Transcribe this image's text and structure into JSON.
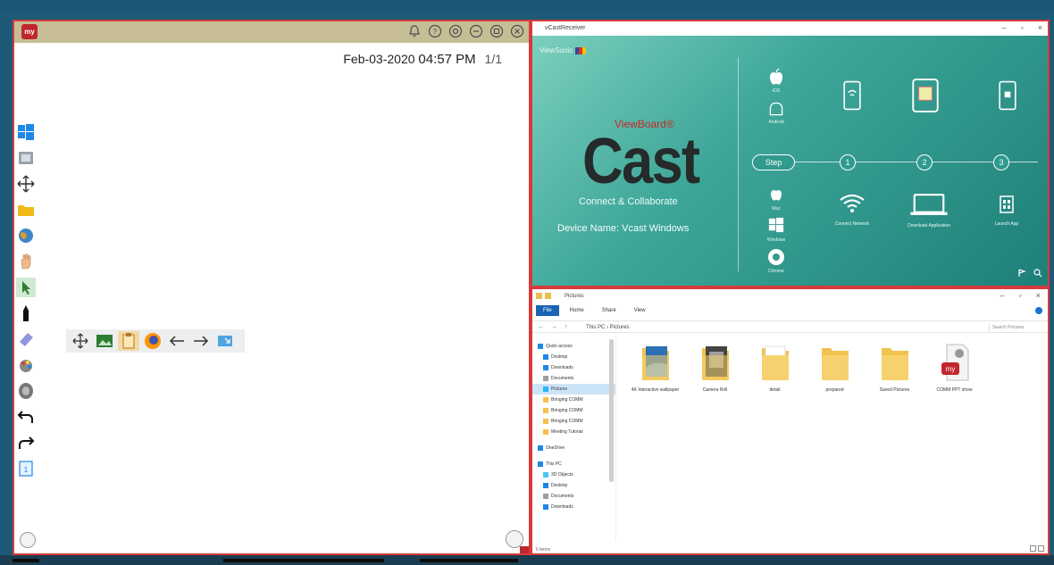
{
  "whiteboard": {
    "logo_text": "my",
    "date": "Feb-03-2020",
    "time": "04:57 PM",
    "page": "1/1",
    "header_icons": [
      "bell-icon",
      "help-icon",
      "settings-icon",
      "minimize-icon",
      "maximize-icon",
      "close-icon"
    ],
    "tools": [
      "windows-icon",
      "screenshot-icon",
      "move-icon",
      "folder-icon",
      "globe-icon",
      "hand-icon",
      "select-icon",
      "pen-icon",
      "eraser-icon",
      "color-palette-icon",
      "zoom-icon",
      "undo-icon",
      "redo-icon",
      "page-icon"
    ],
    "floating_toolbar": [
      "move-icon",
      "image-icon",
      "clipboard-icon",
      "firefox-icon",
      "arrow-left-icon",
      "arrow-right-icon",
      "screen-icon"
    ]
  },
  "cast": {
    "window_title": "vCastReceiver",
    "brand": "ViewSonic",
    "label": "ViewBoard®",
    "title": "Cast",
    "subtitle": "Connect & Collaborate",
    "device_name": "Device Name: Vcast Windows",
    "step_pill": "Step",
    "steps": [
      "1",
      "2",
      "3"
    ],
    "top_platforms": [
      "iOS",
      "Android"
    ],
    "bottom_platforms": [
      "Mac",
      "Windows",
      "Chrome"
    ],
    "step_captions": [
      "Connect Network",
      "Download Application",
      "Launch App"
    ],
    "colors": {
      "accent_red": "#c62828",
      "teal": "#2f9a8d"
    }
  },
  "explorer": {
    "window_title": "Pictures",
    "ribbon_tabs": [
      "File",
      "Home",
      "Share",
      "View"
    ],
    "address_path": "This PC  ›  Pictures",
    "search_placeholder": "Search Pictures",
    "sidebar": [
      {
        "label": "Quick access",
        "icon": "star-icon",
        "group": true
      },
      {
        "label": "Desktop",
        "icon": "desktop-icon"
      },
      {
        "label": "Downloads",
        "icon": "download-icon"
      },
      {
        "label": "Documents",
        "icon": "documents-icon"
      },
      {
        "label": "Pictures",
        "icon": "pictures-icon",
        "selected": true
      },
      {
        "label": "Bringing COMM",
        "icon": "folder-icon"
      },
      {
        "label": "Bringing COMM",
        "icon": "folder-icon"
      },
      {
        "label": "Bringing COMM",
        "icon": "folder-icon"
      },
      {
        "label": "Meeting Tutorial",
        "icon": "folder-icon"
      },
      {
        "label": "OneDrive",
        "icon": "cloud-icon",
        "group": true
      },
      {
        "label": "This PC",
        "icon": "pc-icon",
        "group": true
      },
      {
        "label": "3D Objects",
        "icon": "cube-icon"
      },
      {
        "label": "Desktop",
        "icon": "desktop-icon"
      },
      {
        "label": "Documents",
        "icon": "documents-icon"
      },
      {
        "label": "Downloads",
        "icon": "download-icon"
      }
    ],
    "files": [
      {
        "name": "4K Interactive wallpaper",
        "kind": "folder-photo-blue"
      },
      {
        "name": "Camera Roll",
        "kind": "folder-photo-dark"
      },
      {
        "name": "detail",
        "kind": "folder"
      },
      {
        "name": "prepared",
        "kind": "folder"
      },
      {
        "name": "Saved Pictures",
        "kind": "folder"
      },
      {
        "name": "COMM PPT show",
        "kind": "app-file"
      }
    ],
    "status": "6 items"
  }
}
